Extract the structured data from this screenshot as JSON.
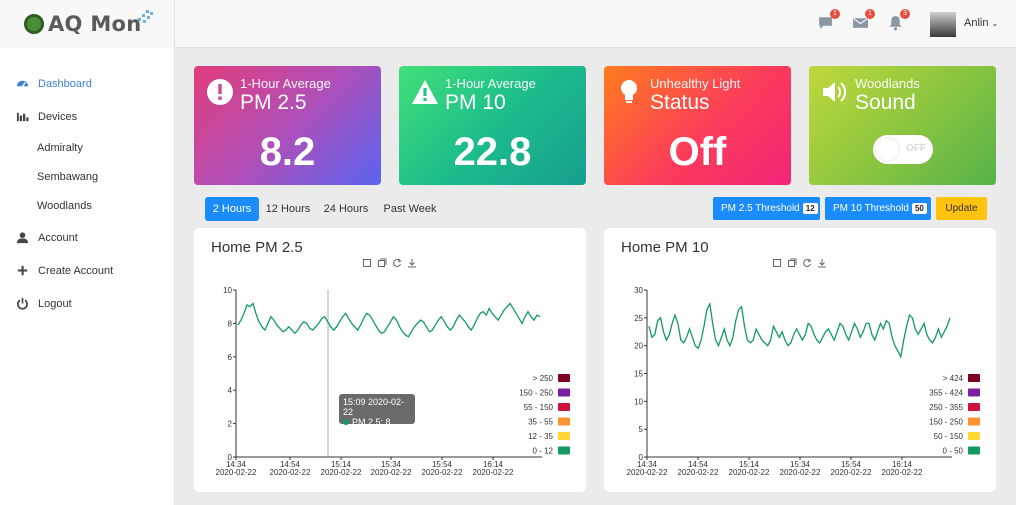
{
  "brand": {
    "name": "AQ Mon"
  },
  "topbar": {
    "notifications": [
      {
        "icon": "chat-icon",
        "count": "1"
      },
      {
        "icon": "mail-icon",
        "count": "1"
      },
      {
        "icon": "bell-icon",
        "count": "3"
      }
    ],
    "user": {
      "name": "Anlin"
    }
  },
  "sidebar": {
    "items": [
      {
        "label": "Dashboard",
        "icon": "gauge-icon"
      },
      {
        "label": "Devices",
        "icon": "bar-chart-icon"
      },
      {
        "label": "Admiralty"
      },
      {
        "label": "Sembawang"
      },
      {
        "label": "Woodlands"
      },
      {
        "label": "Account",
        "icon": "user-icon"
      },
      {
        "label": "Create Account",
        "icon": "plus-icon"
      },
      {
        "label": "Logout",
        "icon": "power-icon"
      }
    ]
  },
  "cards": [
    {
      "title": "1-Hour Average",
      "sub": "PM 2.5",
      "value": "8.2",
      "icon": "alert-circle-icon"
    },
    {
      "title": "1-Hour Average",
      "sub": "PM 10",
      "value": "22.8",
      "icon": "warning-triangle-icon"
    },
    {
      "title": "Unhealthy Light",
      "sub": "Status",
      "value": "Off",
      "icon": "lightbulb-icon"
    },
    {
      "title": "Woodlands",
      "sub": "Sound",
      "toggle": "OFF",
      "icon": "speaker-icon"
    }
  ],
  "range_tabs": [
    "2 Hours",
    "12 Hours",
    "24 Hours",
    "Past Week"
  ],
  "thresholds": {
    "pm25_label": "PM 2.5 Threshold",
    "pm25_value": "12",
    "pm10_label": "PM 10 Threshold",
    "pm10_value": "50",
    "update_label": "Update"
  },
  "tooltip": {
    "time": "15:09 2020-02-22",
    "series": "PM 2.5: 8"
  },
  "chart_data": [
    {
      "type": "line",
      "title": "Home PM 2.5",
      "ylim": [
        0,
        10
      ],
      "yticks": [
        0,
        2,
        4,
        6,
        8,
        10
      ],
      "x_tick_times": [
        "14:34",
        "14:54",
        "15:14",
        "15:34",
        "15:54",
        "16:14"
      ],
      "x_tick_date": "2020-02-22",
      "legend": [
        {
          "label": "> 250",
          "color": "#7e0023"
        },
        {
          "label": "150 - 250",
          "color": "#7b1fa2"
        },
        {
          "label": "55 - 150",
          "color": "#d0103a"
        },
        {
          "label": "35 - 55",
          "color": "#ff9130"
        },
        {
          "label": "12 - 35",
          "color": "#ffd632"
        },
        {
          "label": "0 - 12",
          "color": "#129a61"
        }
      ],
      "series": [
        {
          "color": "#129a61",
          "values": [
            7.9,
            8.2,
            8.6,
            9.1,
            9.0,
            9.2,
            8.6,
            8.1,
            7.8,
            7.6,
            8.0,
            8.4,
            8.2,
            7.9,
            7.7,
            7.5,
            7.6,
            7.8,
            7.6,
            7.4,
            7.6,
            7.9,
            8.1,
            8.0,
            7.7,
            7.6,
            7.8,
            8.0,
            8.3,
            8.4,
            8.1,
            7.8,
            7.6,
            7.8,
            8.1,
            8.4,
            8.6,
            8.3,
            8.0,
            7.8,
            7.6,
            7.9,
            8.3,
            8.6,
            8.5,
            8.2,
            7.9,
            7.6,
            7.4,
            7.5,
            7.8,
            8.1,
            8.4,
            8.2,
            7.8,
            7.5,
            7.3,
            7.2,
            7.5,
            7.8,
            8.0,
            8.2,
            8.1,
            7.8,
            7.5,
            7.6,
            7.9,
            8.2,
            8.4,
            8.1,
            7.8,
            7.6,
            7.8,
            8.2,
            8.5,
            8.3,
            8.1,
            7.8,
            7.6,
            7.9,
            8.3,
            8.6,
            8.7,
            8.5,
            8.9,
            8.6,
            8.4,
            8.2,
            8.5,
            8.8,
            9.0,
            9.2,
            8.9,
            8.6,
            8.3,
            8.0,
            8.4,
            8.7,
            8.4,
            8.2,
            8.5,
            8.4
          ]
        }
      ]
    },
    {
      "type": "line",
      "title": "Home PM 10",
      "ylim": [
        0,
        30
      ],
      "yticks": [
        0,
        5,
        10,
        15,
        20,
        25,
        30
      ],
      "x_tick_times": [
        "14:34",
        "14:54",
        "15:14",
        "15:34",
        "15:54",
        "16:14"
      ],
      "x_tick_date": "2020-02-22",
      "legend": [
        {
          "label": "> 424",
          "color": "#7e0023"
        },
        {
          "label": "355 - 424",
          "color": "#7b1fa2"
        },
        {
          "label": "250 - 355",
          "color": "#d0103a"
        },
        {
          "label": "150 - 250",
          "color": "#ff9130"
        },
        {
          "label": "50 - 150",
          "color": "#ffd632"
        },
        {
          "label": "0 - 50",
          "color": "#129a61"
        }
      ],
      "series": [
        {
          "color": "#129a61",
          "values": [
            23.5,
            21.5,
            22.0,
            24.5,
            25.0,
            22.5,
            21.0,
            22.0,
            24.0,
            25.5,
            24.0,
            21.0,
            20.5,
            21.5,
            23.0,
            21.5,
            20.0,
            19.5,
            21.0,
            23.5,
            26.5,
            27.5,
            24.0,
            21.0,
            20.0,
            21.5,
            23.0,
            21.0,
            20.0,
            21.5,
            24.5,
            26.5,
            27.0,
            23.5,
            21.0,
            20.5,
            21.0,
            23.0,
            22.0,
            21.0,
            20.5,
            20.0,
            21.0,
            23.5,
            22.5,
            21.5,
            22.5,
            21.0,
            20.0,
            20.5,
            22.0,
            23.0,
            22.0,
            21.0,
            22.0,
            24.0,
            23.5,
            22.0,
            21.0,
            20.5,
            21.5,
            22.5,
            23.0,
            22.0,
            21.0,
            22.5,
            24.0,
            23.5,
            22.0,
            21.0,
            22.5,
            24.0,
            23.0,
            21.5,
            22.5,
            24.0,
            24.0,
            22.0,
            21.0,
            22.5,
            24.0,
            23.0,
            24.5,
            24.0,
            21.5,
            20.0,
            19.0,
            18.0,
            21.0,
            23.5,
            25.5,
            25.0,
            23.0,
            22.0,
            23.0,
            24.0,
            22.0,
            21.0,
            20.5,
            21.5,
            23.0,
            21.5,
            22.5,
            23.5,
            25.0
          ]
        }
      ]
    }
  ]
}
